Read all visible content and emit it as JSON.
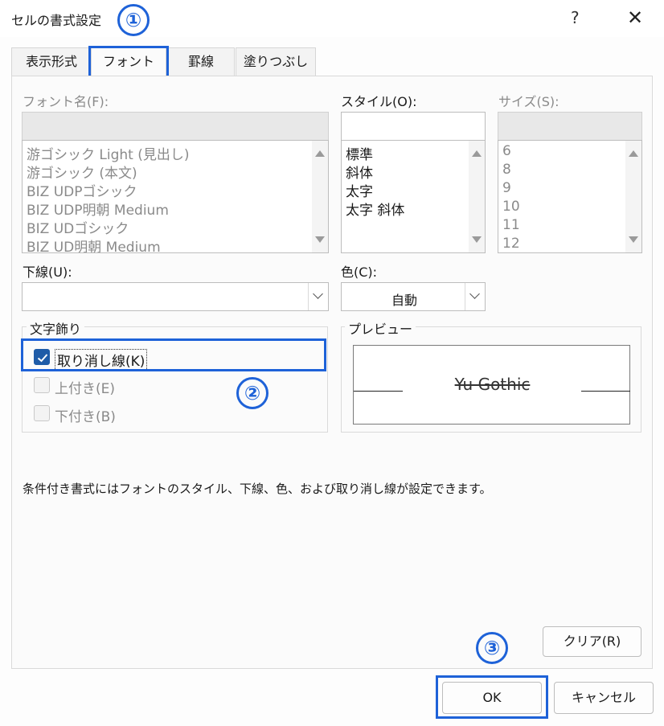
{
  "window": {
    "title": "セルの書式設定",
    "help_label": "?",
    "close_label": "✕"
  },
  "tabs": [
    {
      "label": "表示形式"
    },
    {
      "label": "フォント"
    },
    {
      "label": "罫線"
    },
    {
      "label": "塗りつぶし"
    }
  ],
  "font_name": {
    "label": "フォント名(F):",
    "value": "",
    "items": [
      "游ゴシック Light (見出し)",
      "游ゴシック (本文)",
      "BIZ UDPゴシック",
      "BIZ UDP明朝 Medium",
      "BIZ UDゴシック",
      "BIZ UD明朝 Medium"
    ]
  },
  "style": {
    "label": "スタイル(O):",
    "value": "",
    "items": [
      "標準",
      "斜体",
      "太字",
      "太字 斜体"
    ]
  },
  "size": {
    "label": "サイズ(S):",
    "value": "",
    "items": [
      "6",
      "8",
      "9",
      "10",
      "11",
      "12"
    ]
  },
  "underline": {
    "label": "下線(U):",
    "value": ""
  },
  "color": {
    "label": "色(C):",
    "value": "自動"
  },
  "effects": {
    "title": "文字飾り",
    "strikethrough": {
      "label": "取り消し線(K)",
      "checked": true
    },
    "superscript": {
      "label": "上付き(E)",
      "checked": false
    },
    "subscript": {
      "label": "下付き(B)",
      "checked": false
    }
  },
  "preview": {
    "title": "プレビュー",
    "sample": "Yu Gothic"
  },
  "note": "条件付き書式にはフォントのスタイル、下線、色、および取り消し線が設定できます。",
  "buttons": {
    "clear": "クリア(R)",
    "ok": "OK",
    "cancel": "キャンセル"
  },
  "annotations": [
    "①",
    "②",
    "③"
  ],
  "colors": {
    "annotation": "#1e62d8",
    "checkbox_checked": "#1f5ca8"
  }
}
